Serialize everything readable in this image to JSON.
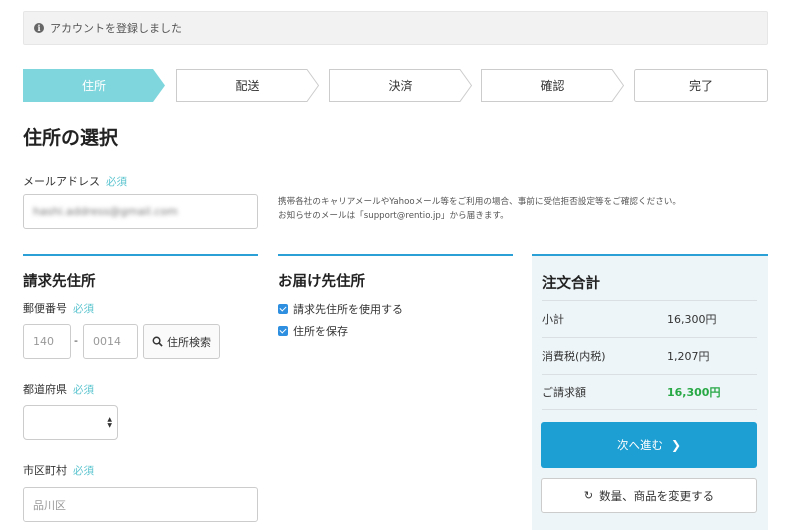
{
  "alert": {
    "icon": "info-icon",
    "text": "アカウントを登録しました"
  },
  "steps": [
    {
      "label": "住所",
      "active": true
    },
    {
      "label": "配送",
      "active": false
    },
    {
      "label": "決済",
      "active": false
    },
    {
      "label": "確認",
      "active": false
    },
    {
      "label": "完了",
      "active": false
    }
  ],
  "page_title": "住所の選択",
  "email": {
    "label": "メールアドレス",
    "required": "必須",
    "value": "hashi.address@gmail.com",
    "note_line1": "携帯各社のキャリアメールやYahooメール等をご利用の場合、事前に受信拒否設定等をご確認ください。",
    "note_line2": "お知らせのメールは「support@rentio.jp」から届きます。"
  },
  "billing": {
    "title": "請求先住所",
    "postal_label": "郵便番号",
    "required": "必須",
    "postal1_placeholder": "140",
    "postal_sep": "-",
    "postal2_placeholder": "0014",
    "search_button": "住所検索",
    "prefecture_label": "都道府県",
    "city_label": "市区町村",
    "city_placeholder": "品川区"
  },
  "shipping": {
    "title": "お届け先住所",
    "use_billing": "請求先住所を使用する",
    "save_address": "住所を保存"
  },
  "summary": {
    "title": "注文合計",
    "rows": [
      {
        "label": "小計",
        "value": "16,300円"
      },
      {
        "label": "消費税(内税)",
        "value": "1,207円"
      },
      {
        "label": "ご請求額",
        "value": "16,300円"
      }
    ],
    "next_button": "次へ進む",
    "change_button": "数量、商品を変更する"
  },
  "colors": {
    "accent": "#2aa0d6",
    "active_step": "#7fd6dd",
    "total": "#27a845",
    "required": "#5bc4cf"
  }
}
